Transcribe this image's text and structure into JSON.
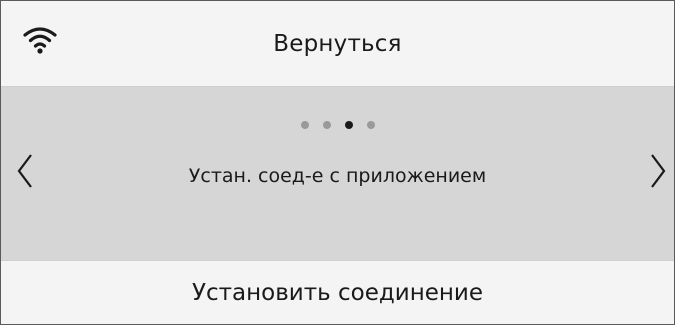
{
  "header": {
    "wifi_icon": "wifi-icon",
    "back_label": "Вернуться"
  },
  "carousel": {
    "page_count": 4,
    "active_page": 3,
    "current_label": "Устан. соед-е с приложением",
    "prev_icon": "chevron-left-icon",
    "next_icon": "chevron-right-icon"
  },
  "footer": {
    "action_label": "Установить соединение"
  },
  "colors": {
    "header_bg": "#f4f4f4",
    "carousel_bg": "#d6d6d6",
    "dot_inactive": "#9a9a9a",
    "dot_active": "#1a1a1a",
    "text": "#1a1a1a"
  }
}
